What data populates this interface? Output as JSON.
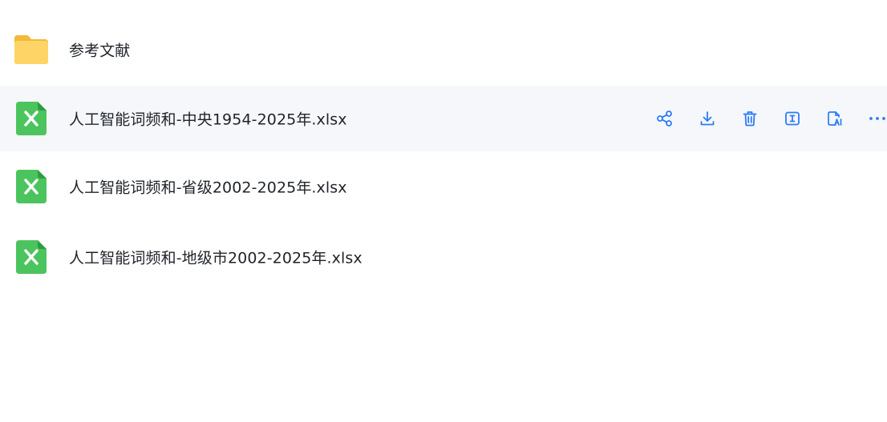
{
  "colors": {
    "accent": "#2b7cf6",
    "folder": "#ffc94d",
    "excel_green": "#2fb34a",
    "row_hover": "#f5f7fb"
  },
  "files": [
    {
      "name": "参考文献",
      "type": "folder",
      "icon": "folder-icon"
    },
    {
      "name": "人工智能词频和-中央1954-2025年.xlsx",
      "type": "excel",
      "icon": "excel-file-icon",
      "hovered": true
    },
    {
      "name": "人工智能词频和-省级2002-2025年.xlsx",
      "type": "excel",
      "icon": "excel-file-icon"
    },
    {
      "name": "人工智能词频和-地级市2002-2025年.xlsx",
      "type": "excel",
      "icon": "excel-file-icon"
    }
  ],
  "row_actions": [
    {
      "icon": "share-icon"
    },
    {
      "icon": "download-icon"
    },
    {
      "icon": "delete-icon"
    },
    {
      "icon": "rename-icon"
    },
    {
      "icon": "ai-read-icon"
    },
    {
      "icon": "more-icon"
    }
  ]
}
